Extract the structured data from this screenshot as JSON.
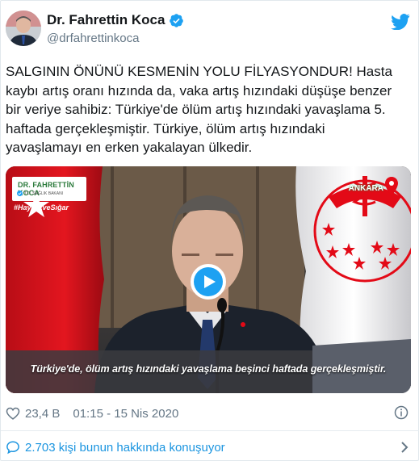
{
  "author": {
    "name": "Dr. Fahrettin Koca",
    "handle": "@drfahrettinkoca",
    "verified": true
  },
  "icons": {
    "platform": "twitter-bird-icon",
    "verified": "verified-badge-icon",
    "like": "heart-icon",
    "info": "info-icon",
    "conversation": "speech-bubble-icon",
    "chevron": "chevron-right-icon",
    "play": "play-icon"
  },
  "tweet": {
    "text": "SALGININ ÖNÜNÜ KESMENİN YOLU FİLYASYONDUR! Hasta\nkaybı artış oranı hızında da, vaka artış hızındaki düşüşe benzer\nbir veriye sahibiz: Türkiye'de ölüm artış hızındaki yavaşlama 5.\nhaftada gerçekleşmiştir. Türkiye, ölüm artış hızındaki\nyavaşlamayı en erken yakalayan ülkedir."
  },
  "video": {
    "badge_name": "DR. FAHRETTİN KOCA",
    "badge_sub": "T.C. SAĞLIK BAKANI",
    "hashtag": "#HayatEveSığar",
    "location": "ANKARA",
    "caption": "Türkiye'de, ölüm artış hızındaki yavaşlama beşinci haftada gerçekleşmiştir."
  },
  "meta": {
    "likes": "23,4 B",
    "timestamp": "01:15 - 15 Nis 2020"
  },
  "footer": {
    "conversation": "2.703 kişi bunun hakkında konuşuyor"
  },
  "colors": {
    "twitter_blue": "#1da1f2",
    "link_blue": "#1b95e0",
    "text": "#14171a",
    "secondary": "#657786",
    "turkish_red": "#e30a17",
    "badge_green": "#2b7a3b"
  }
}
